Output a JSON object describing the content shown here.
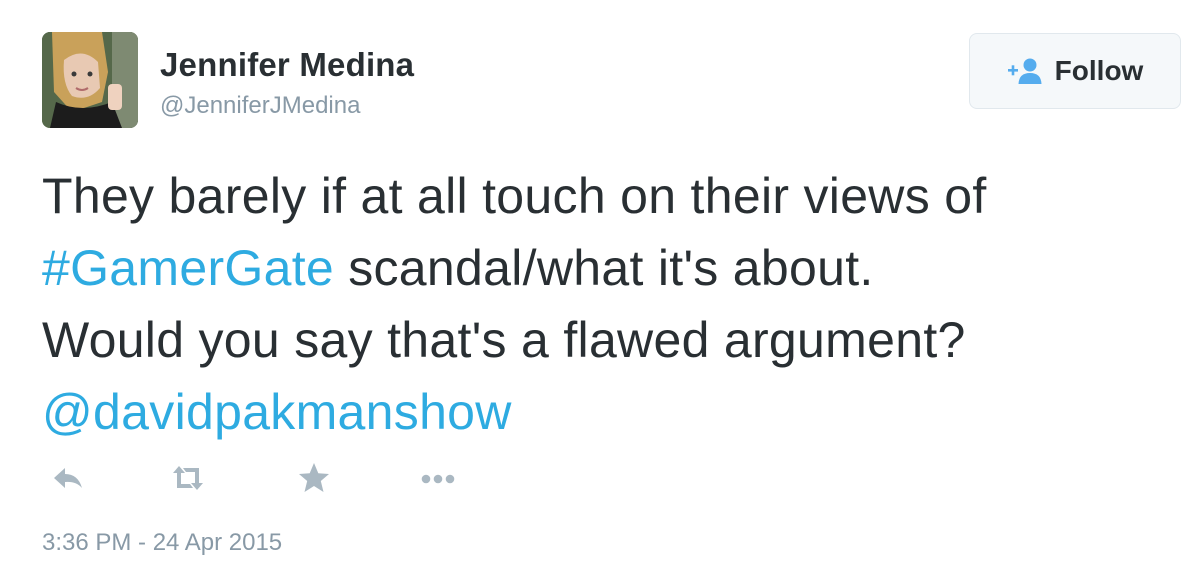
{
  "user": {
    "name": "Jennifer Medina",
    "handle": "@JenniferJMedina",
    "avatar_icon": "profile-photo"
  },
  "follow_button": {
    "label": "Follow",
    "icon": "add-person-icon"
  },
  "tweet": {
    "lines": [
      [
        {
          "text": "They barely if at all touch on their views of",
          "type": "text"
        }
      ],
      [
        {
          "text": "#GamerGate",
          "type": "hashtag"
        },
        {
          "text": " scandal/what it's about.",
          "type": "text"
        }
      ],
      [
        {
          "text": "Would you say that's a flawed argument?",
          "type": "text"
        }
      ],
      [
        {
          "text": "@davidpakmanshow",
          "type": "mention"
        }
      ]
    ]
  },
  "actions": [
    {
      "name": "reply",
      "icon": "reply-icon"
    },
    {
      "name": "retweet",
      "icon": "retweet-icon"
    },
    {
      "name": "favorite",
      "icon": "star-icon"
    },
    {
      "name": "more",
      "icon": "more-dots-icon"
    }
  ],
  "timestamp": "3:36 PM - 24 Apr 2015",
  "colors": {
    "text": "#292f33",
    "secondary": "#8899a6",
    "link": "#2eabe1",
    "icon": "#aab8c2",
    "button_bg": "#f5f8fa",
    "button_border": "#e1e8ed",
    "follow_icon": "#55acee"
  }
}
